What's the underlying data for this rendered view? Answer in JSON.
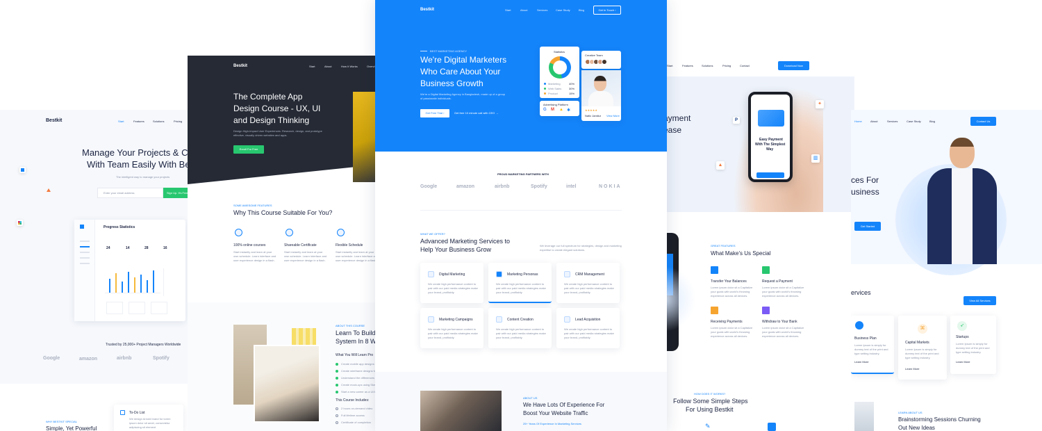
{
  "colors": {
    "primary": "#1484fa",
    "dark": "#252a35",
    "green": "#28c76f",
    "text": "#1b2340",
    "muted": "#8a93a8"
  },
  "p1": {
    "brand": "Bestkit",
    "nav": [
      "Start",
      "Features",
      "Solutions",
      "Pricing"
    ],
    "hero_line1": "Manage Your Projects & Co",
    "hero_line2": "With Team Easily With Be",
    "sub": "The intelligent way to manage your projects",
    "email_placeholder": "Enter your email address",
    "signup": "Sign Up. It's Free",
    "dash_title": "Progress Statistics",
    "dash_nums": [
      "24",
      "14",
      "28",
      "16"
    ],
    "trusted": "Trusted by 25,000+ Project Managers Worldwide",
    "logos": [
      "Google",
      "amazon",
      "airbnb",
      "Spotify"
    ],
    "why_label": "WHY BESTKIT SPECIAL",
    "why_title": "Simple, Yet Powerful",
    "todo_title": "To-Do List"
  },
  "p2": {
    "brand": "Bestkit",
    "nav": [
      "Start",
      "About",
      "How It Works",
      "Overvi"
    ],
    "title_l1": "The Complete App",
    "title_l2": "Design Course - UX, UI",
    "title_l3": "and Design Thinking",
    "desc": "Design High-Impact User Experiences. Research, design, and prototype effective, visually driven websites and apps.",
    "enroll": "Enroll For Free",
    "feat_label": "SOME AWESOME FEATURES",
    "feat_title": "Why This Course Suitable For You?",
    "features": [
      {
        "title": "100% online courses",
        "text": "Start instantly and learn at your own schedule. Learn interface and user experience design in a flash."
      },
      {
        "title": "Shareable Certificate",
        "text": "Start instantly and learn at your own schedule. Learn interface and user experience design in a flash."
      },
      {
        "title": "Flexible Schedule",
        "text": "Start instantly and learn at your own schedule. Learn interface and user experience design in a flash."
      }
    ],
    "about_label": "ABOUT THIS COURSE",
    "about_l1": "Learn To Build",
    "about_l2": "System In 8 We",
    "learn_title": "What You Will Learn Pro",
    "learn_items": [
      "Create mobile app designs fr",
      "Create wireframe designs for",
      "Understand the differences b",
      "Create mock-ups using Sketc",
      "Start a new career as a UI/U"
    ],
    "includes_title": "This Course Includes:",
    "includes_items": [
      "2 hours on-demand video",
      "Full lifetime access",
      "Certificate of completion"
    ]
  },
  "p3": {
    "brand": "Bestkit",
    "nav": [
      "Start",
      "About",
      "Services",
      "Case Study",
      "Blog"
    ],
    "cta": "Get In Touch",
    "eyebrow": "BEST MARKETING AGENCY",
    "title_l1": "We're Digital Marketers",
    "title_l2": "Who Care About Your",
    "title_l3": "Business Growth",
    "desc": "We're a Digital Marketing Agency in Bangladesh, made up of a group of passionate individuals.",
    "free_trial": "Get Free Trial",
    "free_minute": "Get free 10 minute call with CEO",
    "stats_title": "Statistics",
    "stats_items": [
      {
        "name": "Marketing",
        "val": "40%"
      },
      {
        "name": "Web Sales",
        "val": "30%"
      },
      {
        "name": "Product",
        "val": "15%"
      }
    ],
    "creative_team": "Creative Team",
    "adv_platform": "Advertising Platform",
    "person_name": "Nafiz Jamilur",
    "view_more": "View More",
    "partners_label": "PROUD MARKETING PARTNERS WITH",
    "partners": [
      "Google",
      "amazon",
      "airbnb",
      "Spotify",
      "intel",
      "NOKIA"
    ],
    "services_label": "WHAT WE OFFER?",
    "services_l1": "Advanced Marketing Services to",
    "services_l2": "Help Your Business Grow",
    "services_desc": "We leverage our full spectrum for strategies, design and marketing expertise to create elegant solutions.",
    "services": [
      {
        "title": "Digital Marketing",
        "text": "We create high performance content to pair with our paid media strategies make your brand, profitably."
      },
      {
        "title": "Marketing Personas",
        "text": "We create high performance content to pair with our paid media strategies make your brand, profitably."
      },
      {
        "title": "CRM Management",
        "text": "We create high performance content to pair with our paid media strategies make your brand, profitably."
      },
      {
        "title": "Marketing Campaigns",
        "text": "We create high performance content to pair with our paid media strategies make your brand, profitably."
      },
      {
        "title": "Content Creation",
        "text": "We create high performance content to pair with our paid media strategies make your brand, profitably."
      },
      {
        "title": "Lead Acquisition",
        "text": "We create high performance content to pair with our paid media strategies make your brand, profitably."
      }
    ],
    "about_label": "ABOUT US",
    "about_l1": "We Have Lots Of Experience For",
    "about_l2": "Boost Your Website Traffic",
    "about_sub": "25+ Years Of Experience In Marketing Services"
  },
  "p4": {
    "nav": [
      "Start",
      "Features",
      "Solutions",
      "Pricing",
      "Contact"
    ],
    "download": "Download Now",
    "hero_l1": "ayment",
    "hero_l2": "ease",
    "phone_l1": "Easy Payment",
    "phone_l2": "With The Simplest",
    "phone_l3": "Way",
    "feat_label": "GREAT FEATURES",
    "feat_title": "What Make's Us Special",
    "features": [
      {
        "title": "Transfer Your Balances",
        "text": "Lorem ipsum dolor sit a Capitalize your goals with world's throwing experience across all devices."
      },
      {
        "title": "Request a Payment",
        "text": "Lorem ipsum dolor sit a Capitalize your goals with world's throwing experience across all devices."
      },
      {
        "title": "Receiving Payments",
        "text": "Lorem ipsum dolor sit a Capitalize your goals with world's throwing experience across all devices."
      },
      {
        "title": "Withdraw to Your Bank",
        "text": "Lorem ipsum dolor sit a Capitalize your goals with world's throwing experience across all devices."
      }
    ],
    "steps_label": "HOW DOES IT WORKS?",
    "steps_l1": "Follow Some Simple Steps",
    "steps_l2": "For Using Bestkit"
  },
  "p5": {
    "nav": [
      "Home",
      "About",
      "Services",
      "Case Study",
      "Blog"
    ],
    "contact": "Contact Us",
    "hero_l1": "ces For",
    "hero_l2": "usiness",
    "get_started": "Get Started",
    "services_title": "ervices",
    "view_all": "View All Services",
    "cards": [
      {
        "title": "Business Plan",
        "text": "Lorem Ipsum is simply for dummy text of the print and type setting industry.",
        "more": "Learn More"
      },
      {
        "title": "Capital Markets",
        "text": "Lorem Ipsum is simply for dummy text of the print and type setting industry.",
        "more": "Learn More"
      },
      {
        "title": "Startups",
        "text": "Lorem Ipsum is simply for dummy text of the print and type setting industry.",
        "more": "Learn More"
      }
    ],
    "learn_label": "LEARN ABOUT US",
    "learn_l1": "Brainstorming Sessions Churning",
    "learn_l2": "Out New Ideas"
  }
}
